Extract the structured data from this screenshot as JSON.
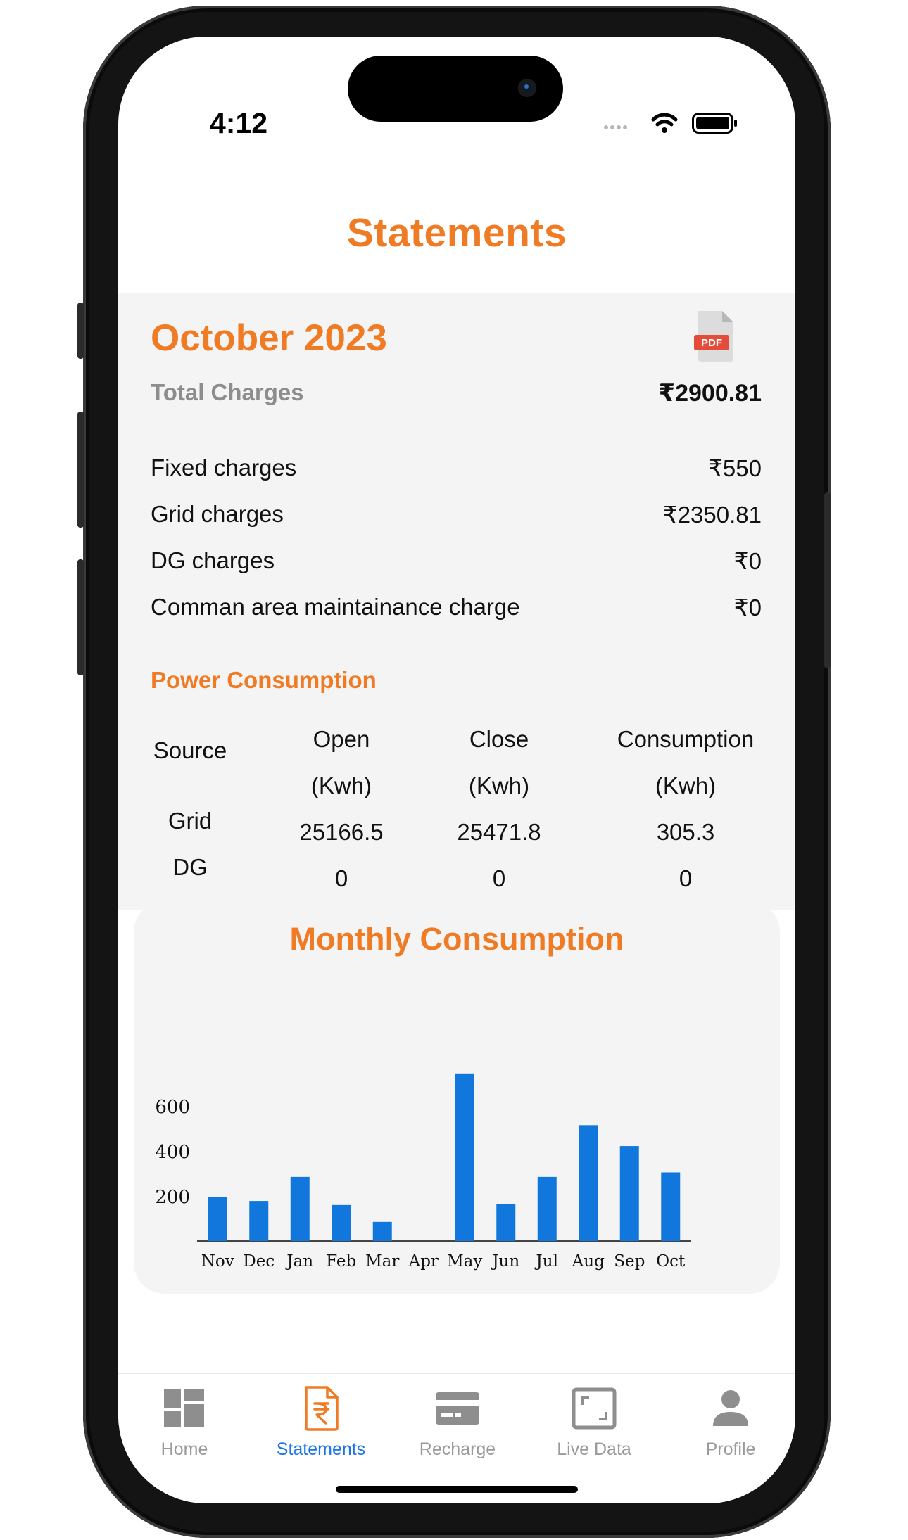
{
  "status_bar": {
    "time": "4:12"
  },
  "header": {
    "title": "Statements"
  },
  "statement": {
    "month": "October 2023",
    "pdf_label": "PDF",
    "total_label": "Total Charges",
    "total_value": "₹2900.81",
    "charges": [
      {
        "label": "Fixed charges",
        "value": "₹550"
      },
      {
        "label": "Grid charges",
        "value": "₹2350.81"
      },
      {
        "label": "DG charges",
        "value": "₹0"
      },
      {
        "label": "Comman area maintainance charge",
        "value": "₹0"
      }
    ]
  },
  "power_consumption": {
    "title": "Power Consumption",
    "columns": [
      "Source",
      "Open",
      "Close",
      "Consumption"
    ],
    "units": [
      "",
      "(Kwh)",
      "(Kwh)",
      "(Kwh)"
    ],
    "rows": [
      {
        "source": "Grid",
        "open": "25166.5",
        "close": "25471.8",
        "consumption": "305.3"
      },
      {
        "source": "DG",
        "open": "0",
        "close": "0",
        "consumption": "0"
      }
    ]
  },
  "chart_title": "Monthly Consumption",
  "chart_data": {
    "type": "bar",
    "categories": [
      "Nov",
      "Dec",
      "Jan",
      "Feb",
      "Mar",
      "Apr",
      "May",
      "Jun",
      "Jul",
      "Aug",
      "Sep",
      "Oct"
    ],
    "values": [
      195,
      178,
      285,
      160,
      85,
      0,
      745,
      165,
      285,
      515,
      422,
      305
    ],
    "yticks": [
      200,
      400,
      600
    ],
    "ylim": [
      0,
      760
    ],
    "bar_color": "#1177dd"
  },
  "tabbar": {
    "items": [
      {
        "label": "Home",
        "icon": "grid-icon",
        "active": false
      },
      {
        "label": "Statements",
        "icon": "rupee-document-icon",
        "active": true
      },
      {
        "label": "Recharge",
        "icon": "card-icon",
        "active": false
      },
      {
        "label": "Live Data",
        "icon": "frame-icon",
        "active": false
      },
      {
        "label": "Profile",
        "icon": "person-icon",
        "active": false
      }
    ]
  },
  "colors": {
    "accent": "#f07b25",
    "active_tab": "#1a73e8",
    "panel_bg": "#f4f4f4"
  }
}
